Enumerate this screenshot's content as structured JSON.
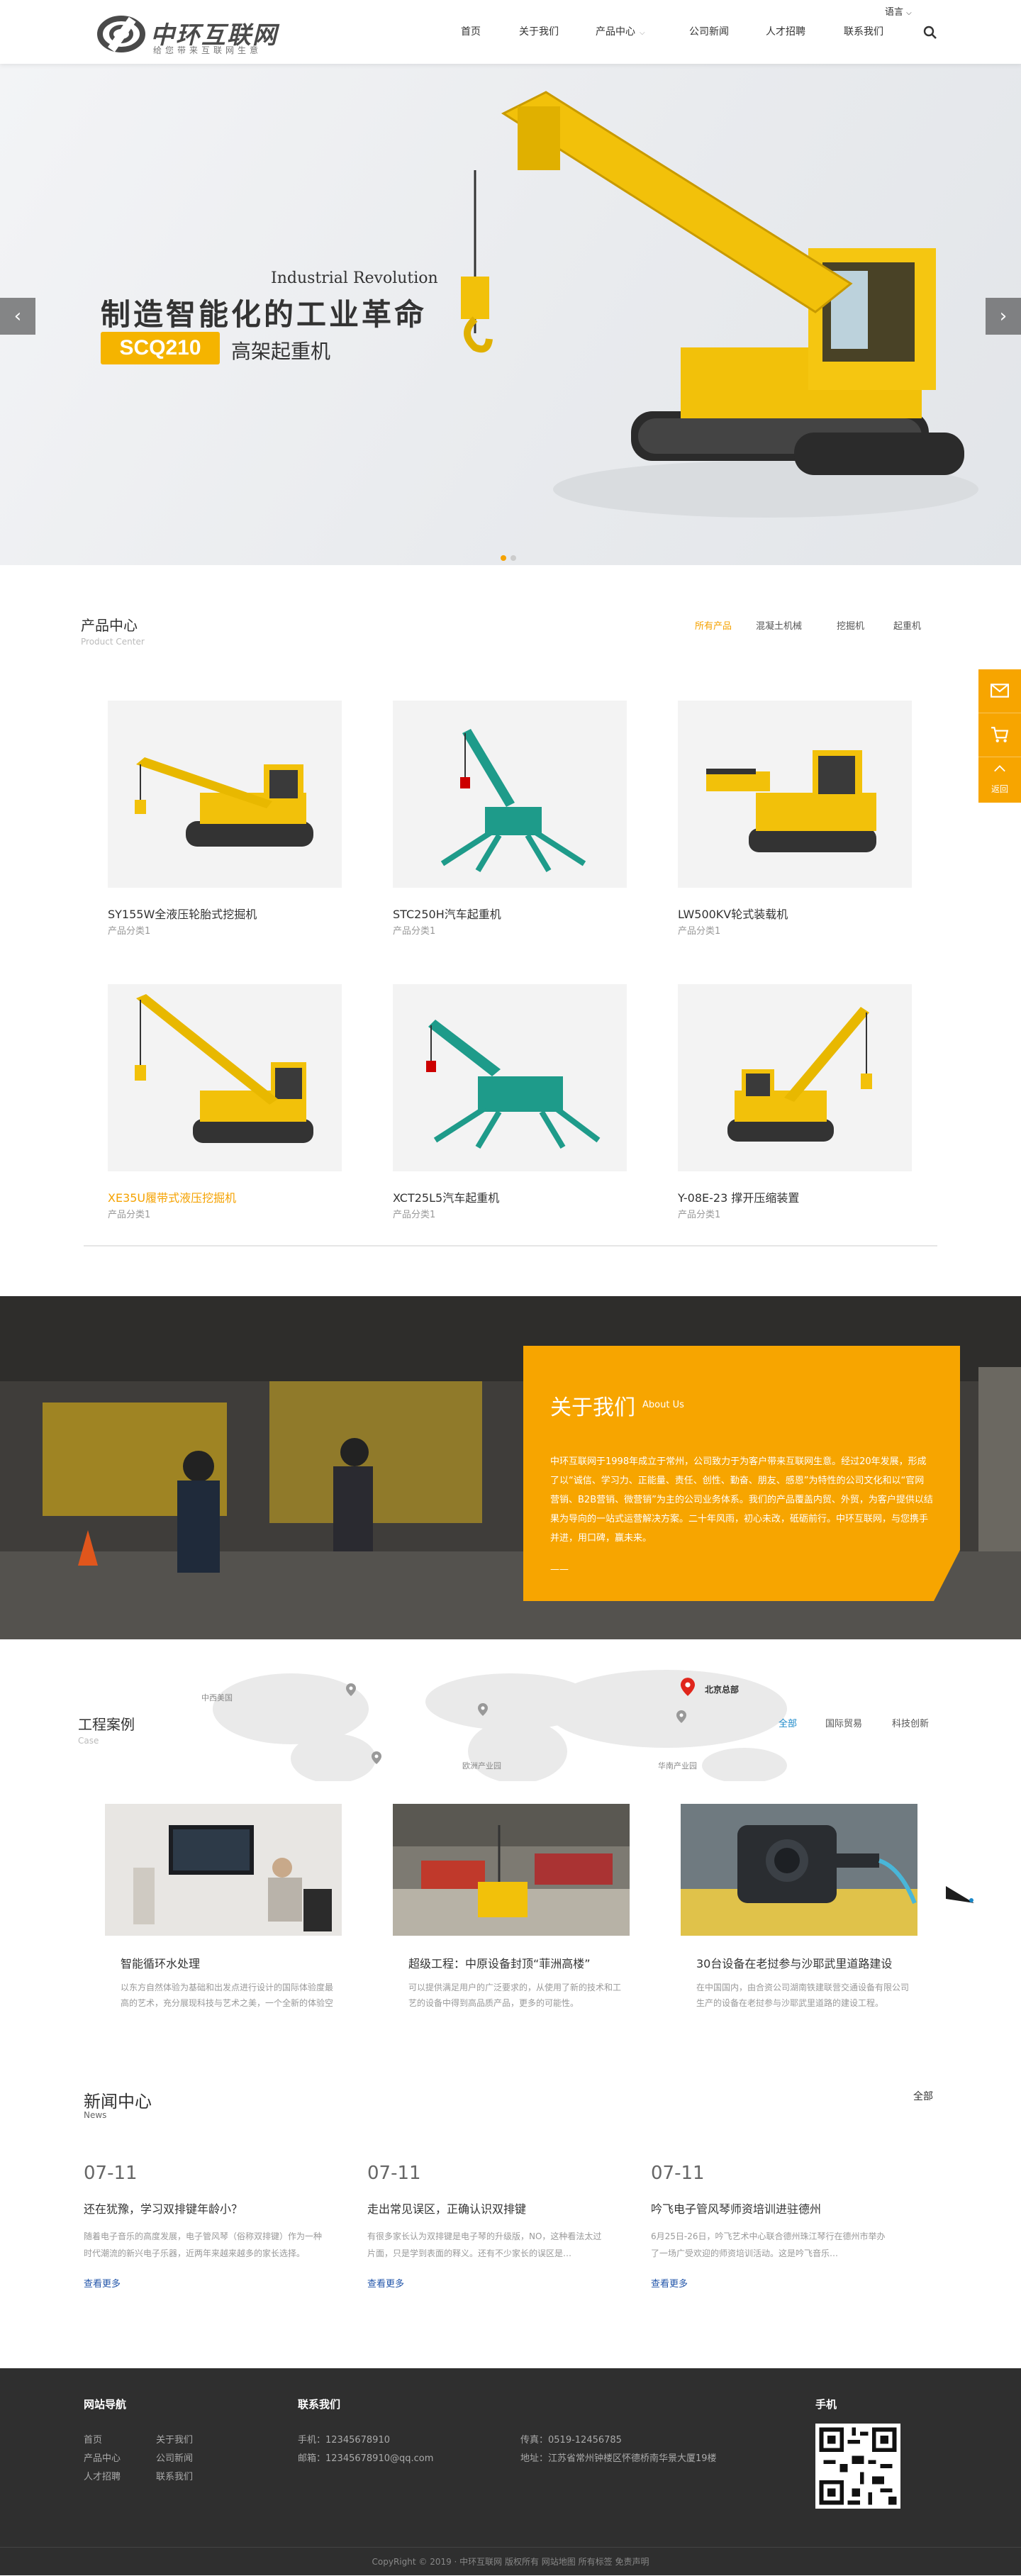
{
  "header": {
    "logo_cn": "中环互联网",
    "logo_sub": "给您带来互联网生意",
    "lang": "语言",
    "nav": [
      "首页",
      "关于我们",
      "产品中心",
      "公司新闻",
      "人才招聘",
      "联系我们"
    ]
  },
  "banner": {
    "industrial": "Industrial Revolution",
    "title": "制造智能化的工业革命",
    "model": "SCQ210",
    "model_name": "高架起重机",
    "prev": "‹",
    "next": "›"
  },
  "side": {
    "top": "返回"
  },
  "products": {
    "title": "产品中心",
    "subtitle": "Product Center",
    "tabs": [
      "所有产品",
      "混凝土机械",
      "挖掘机",
      "起重机"
    ],
    "items": [
      {
        "name": "SY155W全液压轮胎式挖掘机",
        "cat": "产品分类1"
      },
      {
        "name": "STC250H汽车起重机",
        "cat": "产品分类1"
      },
      {
        "name": "LW500KV轮式装载机",
        "cat": "产品分类1"
      },
      {
        "name": "XE35U履带式液压挖掘机",
        "cat": "产品分类1"
      },
      {
        "name": "XCT25L5汽车起重机",
        "cat": "产品分类1"
      },
      {
        "name": "Y-08E-23 撑开压缩装置",
        "cat": "产品分类1"
      }
    ]
  },
  "about": {
    "title": "关于我们",
    "title_en": "About Us",
    "text": "中环互联网于1998年成立于常州，公司致力于为客户带来互联网生意。经过20年发展，形成了以“诚信、学习力、正能量、责任、创性、勤奋、朋友、感恩”为特性的公司文化和以“官网营销、B2B营销、微营销”为主的公司业务体系。我们的产品覆盖内贸、外贸，为客户提供以结果为导向的一站式运营解决方案。二十年风雨，初心未改，砥砺前行。中环互联网，与您携手并进，用口碑，赢未来。",
    "more": "——"
  },
  "cases": {
    "title": "工程案例",
    "subtitle": "Case",
    "tabs": [
      "全部",
      "国际贸易",
      "科技创新"
    ],
    "map_labels": [
      "中西美国",
      "北京总部",
      "欧洲产业园",
      "华南产业园"
    ],
    "items": [
      {
        "title": "智能循环水处理",
        "desc": "以东方自然体验为基础和出发点进行设计的国际体验度最高的艺术，充分展现科技与艺术之美，一个全新的体验空间。"
      },
      {
        "title": "超级工程：中原设备封顶“菲洲高楼”",
        "desc": "可以提供满足用户的广泛要求的，从使用了新的技术和工艺的设备中得到高品质产品，更多的可能性。"
      },
      {
        "title": "30台设备在老挝参与沙耶武里道路建设",
        "desc": "在中国国内，由合资公司湖南铁建联营交通设备有限公司生产的设备在老挝参与沙耶武里道路的建设工程。"
      }
    ]
  },
  "news": {
    "title": "新闻中心",
    "subtitle": "News",
    "all": "全部",
    "items": [
      {
        "date": "07-11",
        "title": "还在犹豫，学习双排键年龄小？",
        "desc": "随着电子音乐的高度发展，电子管风琴（俗称双排键）作为一种时代潮流的新兴电子乐器，近两年来越来越多的家长选择。",
        "more": "查看更多"
      },
      {
        "date": "07-11",
        "title": "走出常见误区，正确认识双排键",
        "desc": "有很多家长认为双排键是电子琴的升级版，NO，这种看法太过片面，只是学到表面的释义。还有不少家长的误区是…",
        "more": "查看更多"
      },
      {
        "date": "07-11",
        "title": "吟飞电子管风琴师资培训进驻德州",
        "desc": "6月25日-26日，吟飞艺术中心联合德州珠江琴行在德州市举办了一场广受欢迎的师资培训活动。这是吟飞音乐…",
        "more": "查看更多"
      }
    ]
  },
  "footer": {
    "nav_title": "网站导航",
    "nav_links": [
      "首页",
      "关于我们",
      "产品中心",
      "公司新闻",
      "人才招聘",
      "联系我们"
    ],
    "contact_title": "联系我们",
    "phone": "手机：12345678910",
    "email": "邮箱：12345678910@qq.com",
    "fax": "传真：0519-12456785",
    "address": "地址：江苏省常州钟楼区怀德桥南华景大厦19楼",
    "mobile_title": "手机",
    "copyright": "CopyRight © 2019 · 中环互联网 版权所有    网站地图  所有标签  免责声明"
  }
}
